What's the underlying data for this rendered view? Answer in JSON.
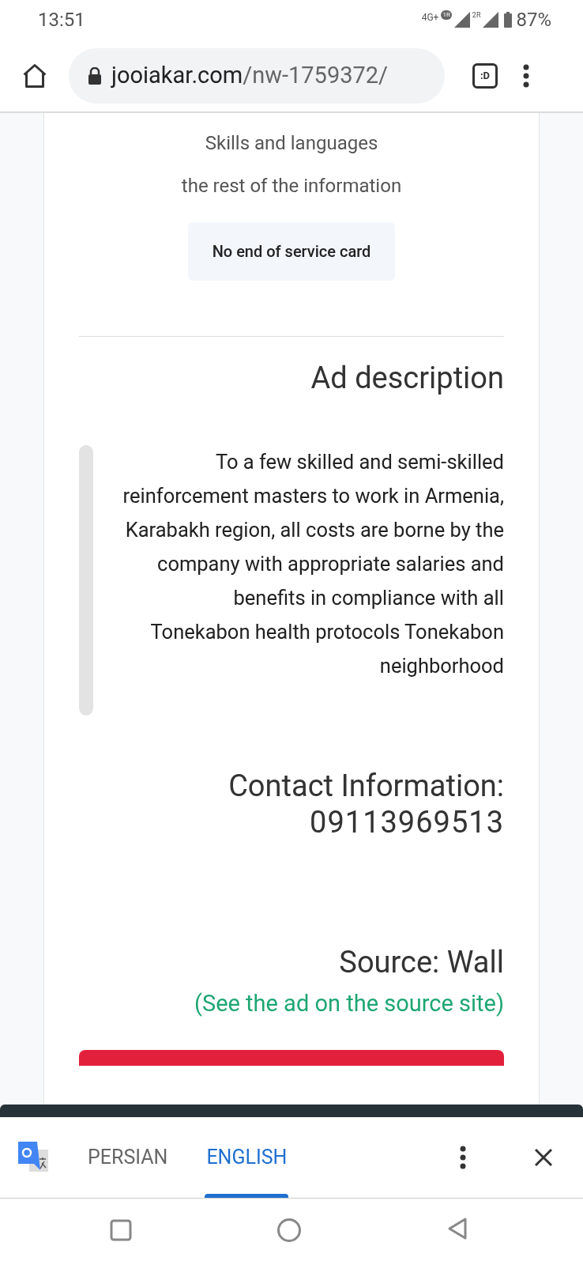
{
  "status_bar": {
    "time": "13:51",
    "network": "4G+",
    "sim_1": "1R",
    "sim_2": "2R",
    "battery": "87%"
  },
  "browser": {
    "url_domain": "jooiakar.com",
    "url_path": "/nw-1759372/",
    "tab_switcher": ":D"
  },
  "page": {
    "links": [
      "Skills and languages",
      "the rest of the information"
    ],
    "chip": "No end of service card",
    "ad_heading": "Ad description",
    "description": [
      "To a few skilled and semi-skilled reinforcement masters to work in Armenia, Karabakh region, all costs are borne by the company with appropriate salaries and benefits in compliance with all",
      "Tonekabon health protocols Tonekabon neighborhood"
    ],
    "contact_label": "Contact Information:",
    "contact_phone": "09113969513",
    "source": "Source: Wall",
    "source_link": "(See the ad on the source site)"
  },
  "translate_bar": {
    "languages": [
      {
        "label": "PERSIAN",
        "selected": false
      },
      {
        "label": "ENGLISH",
        "selected": true
      }
    ]
  }
}
